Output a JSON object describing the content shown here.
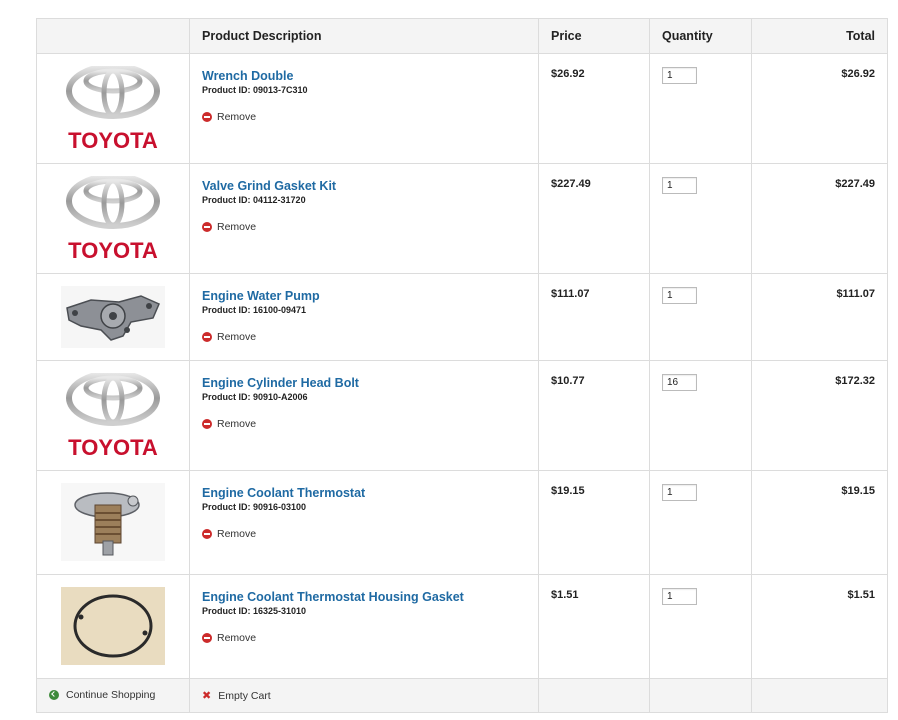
{
  "header": {
    "image_col": "",
    "description": "Product Description",
    "price": "Price",
    "quantity": "Quantity",
    "total": "Total"
  },
  "items": [
    {
      "name": "Wrench Double",
      "pid_label": "Product ID:",
      "pid": "09013-7C310",
      "remove": "Remove",
      "price": "$26.92",
      "qty": "1",
      "total": "$26.92",
      "image": "toyota-logo"
    },
    {
      "name": "Valve Grind Gasket Kit",
      "pid_label": "Product ID:",
      "pid": "04112-31720",
      "remove": "Remove",
      "price": "$227.49",
      "qty": "1",
      "total": "$227.49",
      "image": "toyota-logo"
    },
    {
      "name": "Engine Water Pump",
      "pid_label": "Product ID:",
      "pid": "16100-09471",
      "remove": "Remove",
      "price": "$111.07",
      "qty": "1",
      "total": "$111.07",
      "image": "water-pump-photo"
    },
    {
      "name": "Engine Cylinder Head Bolt",
      "pid_label": "Product ID:",
      "pid": "90910-A2006",
      "remove": "Remove",
      "price": "$10.77",
      "qty": "16",
      "total": "$172.32",
      "image": "toyota-logo"
    },
    {
      "name": "Engine Coolant Thermostat",
      "pid_label": "Product ID:",
      "pid": "90916-03100",
      "remove": "Remove",
      "price": "$19.15",
      "qty": "1",
      "total": "$19.15",
      "image": "thermostat-photo"
    },
    {
      "name": "Engine Coolant Thermostat Housing Gasket",
      "pid_label": "Product ID:",
      "pid": "16325-31010",
      "remove": "Remove",
      "price": "$1.51",
      "qty": "1",
      "total": "$1.51",
      "image": "gasket-photo"
    }
  ],
  "footer": {
    "continue": "Continue Shopping",
    "empty": "Empty Cart"
  },
  "logo_text": "TOYOTA",
  "colors": {
    "link": "#1f6aa3",
    "toyota_red": "#c8102e",
    "remove_red": "#cc2b2b",
    "continue_green": "#3d8a3a"
  }
}
